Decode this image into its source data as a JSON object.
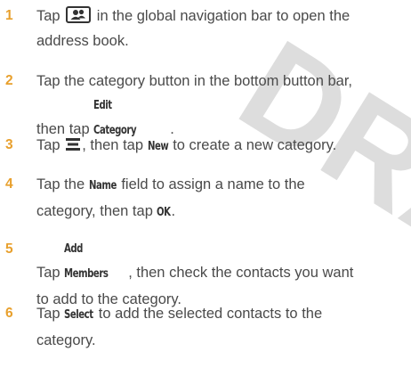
{
  "watermark": {
    "text": "DRAFT",
    "color": "#d3d3d3"
  },
  "steps": [
    {
      "number": "1",
      "icon": "address-book-icon",
      "lines": [
        "Tap",
        "in the global navigation bar to open the",
        "address book."
      ]
    },
    {
      "number": "2",
      "lines": [
        "Tap the category button in the bottom button bar,",
        "then tap"
      ],
      "command": "Edit Category",
      "tail": "."
    },
    {
      "number": "3",
      "icon": "menu-icon",
      "pre": "Tap",
      "mid": ", then tap",
      "command": "New",
      "tail": "to create a new category."
    },
    {
      "number": "4",
      "pre": "Tap the",
      "command": "Name",
      "post": "field to assign a name to the",
      "line2": "category, then tap",
      "command2": "OK",
      "tail": "."
    },
    {
      "number": "5",
      "pre": "Tap",
      "command": "Add Members",
      "post": ", then check the contacts you want",
      "line2": "to add to the category."
    },
    {
      "number": "6",
      "pre": "Tap",
      "command": "Select",
      "post": "to add the selected contacts to the",
      "line2": "category."
    }
  ],
  "colors": {
    "accent": "#e8a02d",
    "text": "#4a4a4a"
  }
}
